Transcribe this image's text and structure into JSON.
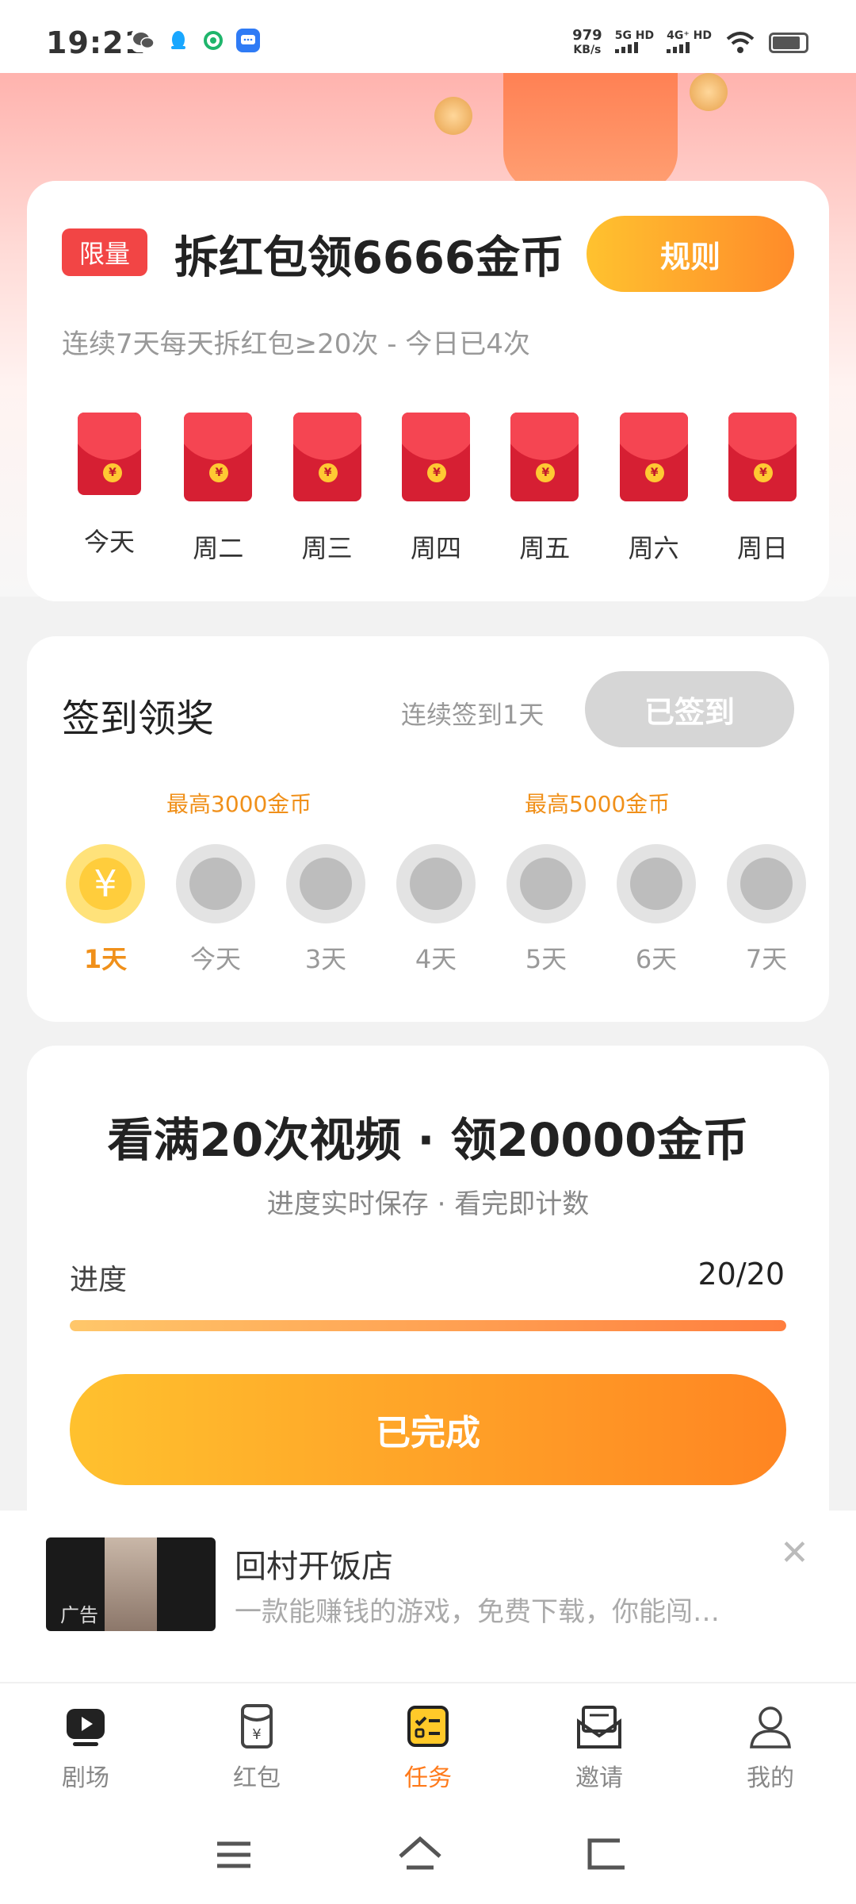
{
  "status_bar": {
    "time": "19:21",
    "speed_value": "979",
    "speed_unit": "KB/s",
    "net1": "5G HD",
    "net2": "4G⁺ HD",
    "app_icons": [
      "wechat-icon",
      "qq-icon",
      "green-app-icon",
      "message-app-icon"
    ]
  },
  "sign_envelope_card": {
    "tag": "限量",
    "title": "拆红包领6666金币",
    "rules_button": "规则",
    "subtitle": "连续7天每天拆红包≥20次 - 今日已4次",
    "days": [
      "今天",
      "周二",
      "周三",
      "周四",
      "周五",
      "周六",
      "周日"
    ]
  },
  "checkin_card": {
    "title": "签到领奖",
    "streak": "连续签到1天",
    "button": "已签到",
    "max1": "最高3000金币",
    "max2": "最高5000金币",
    "days": [
      "1天",
      "今天",
      "3天",
      "4天",
      "5天",
      "6天",
      "7天"
    ],
    "active_day_index": 0
  },
  "video_task": {
    "title": "看满20次视频 · 领20000金币",
    "subtitle": "进度实时保存 · 看完即计数",
    "progress_label": "进度",
    "progress_value": "20/20",
    "progress_fraction": 1.0,
    "button": "已完成"
  },
  "ad": {
    "tag": "广告",
    "title": "回村开饭店",
    "description": "一款能赚钱的游戏，免费下载，你能闯…"
  },
  "tabbar": {
    "items": [
      {
        "label": "剧场",
        "icon": "play-icon"
      },
      {
        "label": "红包",
        "icon": "red-envelope-icon"
      },
      {
        "label": "任务",
        "icon": "task-list-icon"
      },
      {
        "label": "邀请",
        "icon": "invite-mail-icon"
      },
      {
        "label": "我的",
        "icon": "profile-icon"
      }
    ],
    "active_index": 2
  },
  "colors": {
    "accent_orange": "#ff7a1a",
    "brand_red": "#f24545",
    "gold": "#ffcd3c"
  }
}
